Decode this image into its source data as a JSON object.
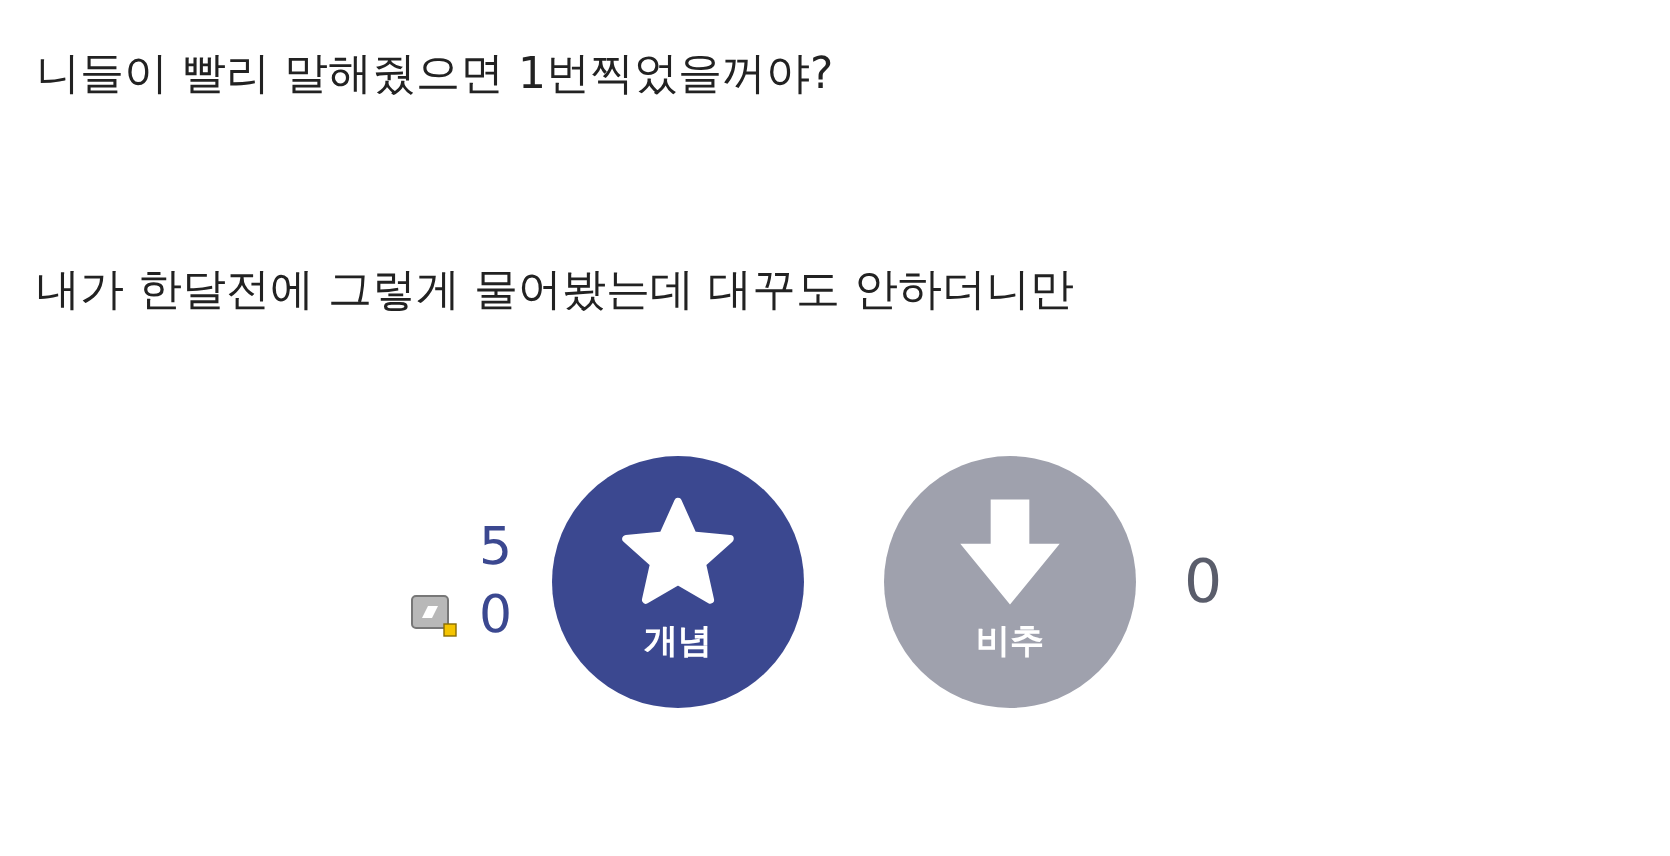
{
  "paragraphs": [
    "니들이 빨리 말해줬으면 1번찍었을꺼야?",
    "내가 한달전에 그렇게 물어봤는데 대꾸도 안하더니만"
  ],
  "vote": {
    "up_count": "5",
    "fixed_up_count": "0",
    "up_label": "개념",
    "down_label": "비추",
    "down_count": "0"
  }
}
